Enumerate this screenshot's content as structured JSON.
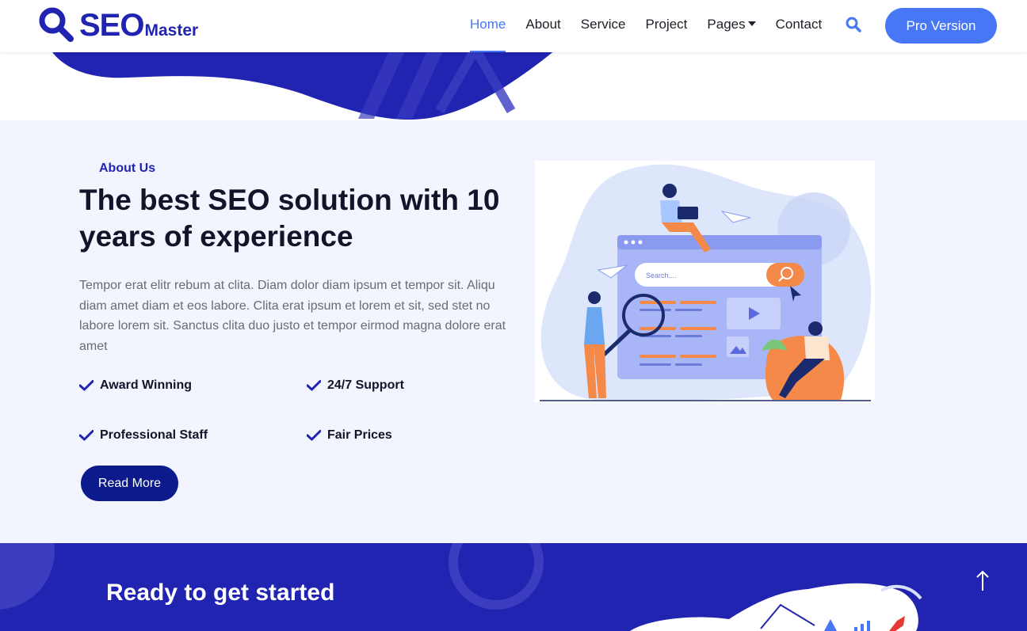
{
  "brand": {
    "name": "SEO",
    "suffix": "Master"
  },
  "nav": {
    "links": [
      "Home",
      "About",
      "Service",
      "Project",
      "Pages",
      "Contact"
    ],
    "active": "Home",
    "cta_label": "Pro Version"
  },
  "about": {
    "kicker": "About Us",
    "title": "The best SEO solution with 10 years of experience",
    "text": "Tempor erat elitr rebum at clita. Diam dolor diam ipsum et tempor sit. Aliqu diam amet diam et eos labore. Clita erat ipsum et lorem et sit, sed stet no labore lorem sit. Sanctus clita duo justo et tempor eirmod magna dolore erat amet",
    "features": [
      "Award Winning",
      "24/7 Support",
      "Professional Staff",
      "Fair Prices"
    ],
    "button_label": "Read More",
    "illustration_search_text": "Search...."
  },
  "cta": {
    "title": "Ready to get started"
  },
  "colors": {
    "primary": "#2124b1",
    "accent": "#4777f5",
    "dark_button": "#0d1a8c",
    "section_bg": "#f2f5fd",
    "text_dark": "#13132a",
    "text_muted": "#6b6a75",
    "illustration_orange": "#f5894a"
  },
  "icons": [
    "magnifier-logo-icon",
    "search-icon",
    "caret-down-icon",
    "check-icon",
    "arrow-up-icon"
  ]
}
